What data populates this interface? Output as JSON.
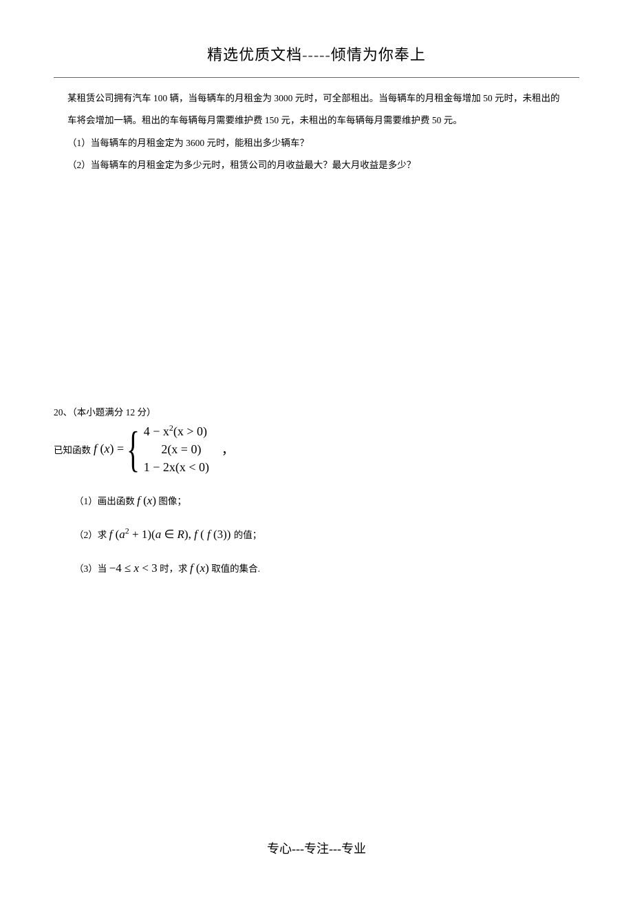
{
  "header": {
    "left": "精选优质文档",
    "dashes": "-----",
    "right": "倾情为你奉上"
  },
  "q19": {
    "p1": "某租赁公司拥有汽车 100 辆，当每辆车的月租金为 3000 元时，可全部租出。当每辆车的月租金每增加 50 元时，未租出的",
    "p2": "车将会增加一辆。租出的车每辆每月需要维护费 150 元，未租出的车每辆每月需要维护费 50 元。",
    "p3": "（1）当每辆车的月租金定为 3600 元时，能租出多少辆车？",
    "p4": "（2）当每辆车的月租金定为多少元时，租赁公司的月收益最大？最大月收益是多少？"
  },
  "q20": {
    "intro": "20、（本小题满分 12 分）",
    "prefix": "已知函数",
    "fx": "f (x) =",
    "cases": {
      "c1a": "4 − x",
      "c1sup": "2",
      "c1b": "(x > 0)",
      "c2": "2(x = 0)",
      "c3": "1 − 2x(x < 0)"
    },
    "sub1_a": "（1）画出函数",
    "sub1_fx": "f (x)",
    "sub1_b": "图像；",
    "sub2_a": "（2）求",
    "sub2_m1a": "f (a",
    "sub2_sup": "2",
    "sub2_m1b": " + 1)(a ∈ R), f ( f (3))",
    "sub2_b": "的值；",
    "sub3_a": "（3）当",
    "sub3_m1": "−4 ≤ x < 3",
    "sub3_b": "时，求",
    "sub3_fx": "f (x)",
    "sub3_c": "取值的集合."
  },
  "footer": {
    "a": "专心",
    "d1": "---",
    "b": "专注",
    "d2": "---",
    "c": "专业"
  }
}
